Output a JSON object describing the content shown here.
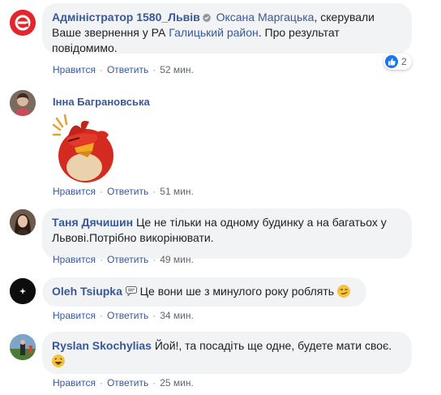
{
  "comments": [
    {
      "author": "Адміністратор 1580_Львів",
      "tag": "Оксана Маргацька",
      "text_parts": [
        ", скерували Ваше звернення у РА ",
        "Галицький район",
        ". Про результат повідомимо."
      ],
      "like_label": "Нравится",
      "reply_label": "Ответить",
      "time": "52 мин.",
      "reaction_count": "2",
      "avatar_icon": "org-logo-icon",
      "verified_icon": "verified-badge-icon"
    },
    {
      "author": "Інна Баграновська",
      "sticker": "angry-bird-facepalm-sticker",
      "like_label": "Нравится",
      "reply_label": "Ответить",
      "time": "51 мин."
    },
    {
      "author": "Таня Дячишин",
      "text": "Це не тільки на одному будинку а на багатьох у Львові.Потрібно викорінювати.",
      "like_label": "Нравится",
      "reply_label": "Ответить",
      "time": "49 мин."
    },
    {
      "author": "Oleh Tsiupka",
      "text": "Це вони ше з минулого року роблять",
      "like_label": "Нравится",
      "reply_label": "Ответить",
      "time": "34 мин.",
      "author_badge_icon": "chat-bubble-icon",
      "emoji_icon": "smirk-face-icon"
    },
    {
      "author": "Ryslan Skochylias",
      "text": "Йой!, та посадіть ще одне, будете мати своє.",
      "like_label": "Нравится",
      "reply_label": "Ответить",
      "time": "25 мин.",
      "emoji_icon": "laughing-face-icon"
    }
  ],
  "colors": {
    "link": "#385898",
    "bubble": "#f2f3f5",
    "like_blue": "#1877f2",
    "meta": "#606770"
  }
}
